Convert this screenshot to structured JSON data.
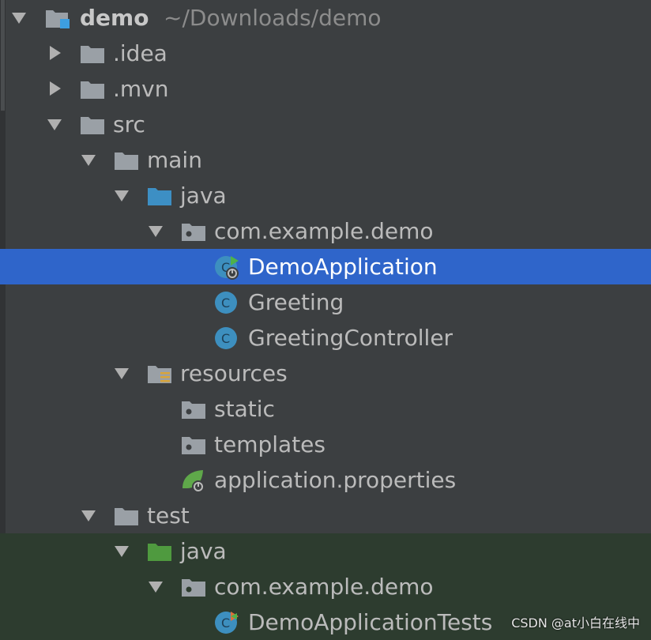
{
  "project_tree": {
    "root": {
      "name": "demo",
      "path": "~/Downloads/demo"
    },
    "items": [
      {
        "label": ".idea",
        "icon": "folder-icon",
        "expanded": false
      },
      {
        "label": ".mvn",
        "icon": "folder-icon",
        "expanded": false
      },
      {
        "label": "src",
        "icon": "folder-icon",
        "expanded": true
      },
      {
        "label": "main",
        "icon": "folder-icon",
        "expanded": true
      },
      {
        "label": "java",
        "icon": "source-folder-icon",
        "expanded": true
      },
      {
        "label": "com.example.demo",
        "icon": "package-icon",
        "expanded": true
      },
      {
        "label": "DemoApplication",
        "icon": "spring-boot-class-icon",
        "selected": true
      },
      {
        "label": "Greeting",
        "icon": "class-icon"
      },
      {
        "label": "GreetingController",
        "icon": "class-icon"
      },
      {
        "label": "resources",
        "icon": "resources-folder-icon",
        "expanded": true
      },
      {
        "label": "static",
        "icon": "package-icon"
      },
      {
        "label": "templates",
        "icon": "package-icon"
      },
      {
        "label": "application.properties",
        "icon": "spring-properties-icon"
      },
      {
        "label": "test",
        "icon": "folder-icon",
        "expanded": true
      },
      {
        "label": "java",
        "icon": "test-source-folder-icon",
        "expanded": true
      },
      {
        "label": "com.example.demo",
        "icon": "package-icon",
        "expanded": true
      },
      {
        "label": "DemoApplicationTests",
        "icon": "test-class-icon"
      }
    ]
  },
  "watermark": "CSDN @at小白在线中",
  "colors": {
    "background": "#3c3f41",
    "selection": "#2f65ca",
    "test_background": "#2d3c2f",
    "folder": "#9aa0a6",
    "source_folder": "#3d8fc4",
    "test_folder": "#4f9a3f",
    "class_icon": "#3d8fbf"
  }
}
